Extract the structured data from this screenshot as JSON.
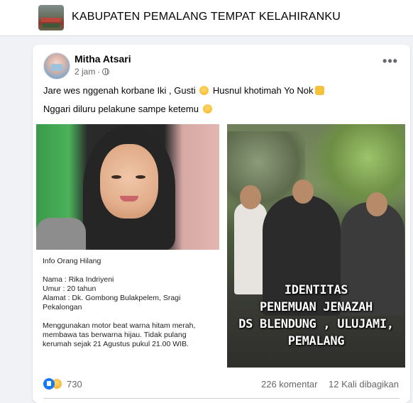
{
  "group": {
    "name": "KABUPATEN PEMALANG TEMPAT KELAHIRANKU"
  },
  "post": {
    "author": "Mitha Atsari",
    "time": "2 jam",
    "visibility_icon": "globe-icon",
    "more_icon": "more-options-icon",
    "more_label": "•••",
    "text_line1_a": "Jare wes nggenah korbane Iki , Gusti",
    "text_line1_b": "Husnul khotimah Yo Nok",
    "text_line2": "Nggari diluru pelakune sampe ketemu",
    "image_left": {
      "info_title": "Info Orang Hilang",
      "nama": "Nama : Rika Indriyeni",
      "umur": "Umur  : 20 tahun",
      "alamat_1": "Alamat : Dk. Gombong Bulakpelem, Sragi",
      "alamat_2": "Pekalongan",
      "desc_1": "Menggunakan motor beat warna hitam merah,",
      "desc_2": "membawa tas berwarna hijau. Tidak pulang",
      "desc_3": "kerumah sejak 21 Agustus pukul 21.00 WIB."
    },
    "image_right": {
      "line1": "IDENTITAS",
      "line2": "PENEMUAN JENAZAH",
      "line3": "DS BLENDUNG , ULUJAMI,",
      "line4": "PEMALANG"
    },
    "reactions": {
      "count": "730",
      "icons": [
        "like-icon",
        "sad-icon"
      ]
    },
    "comments": "226 komentar",
    "shares": "12 Kali dibagikan"
  },
  "colors": {
    "background": "#f0f2f5",
    "card": "#ffffff",
    "secondary_text": "#65676b",
    "like_blue": "#1877f2"
  }
}
